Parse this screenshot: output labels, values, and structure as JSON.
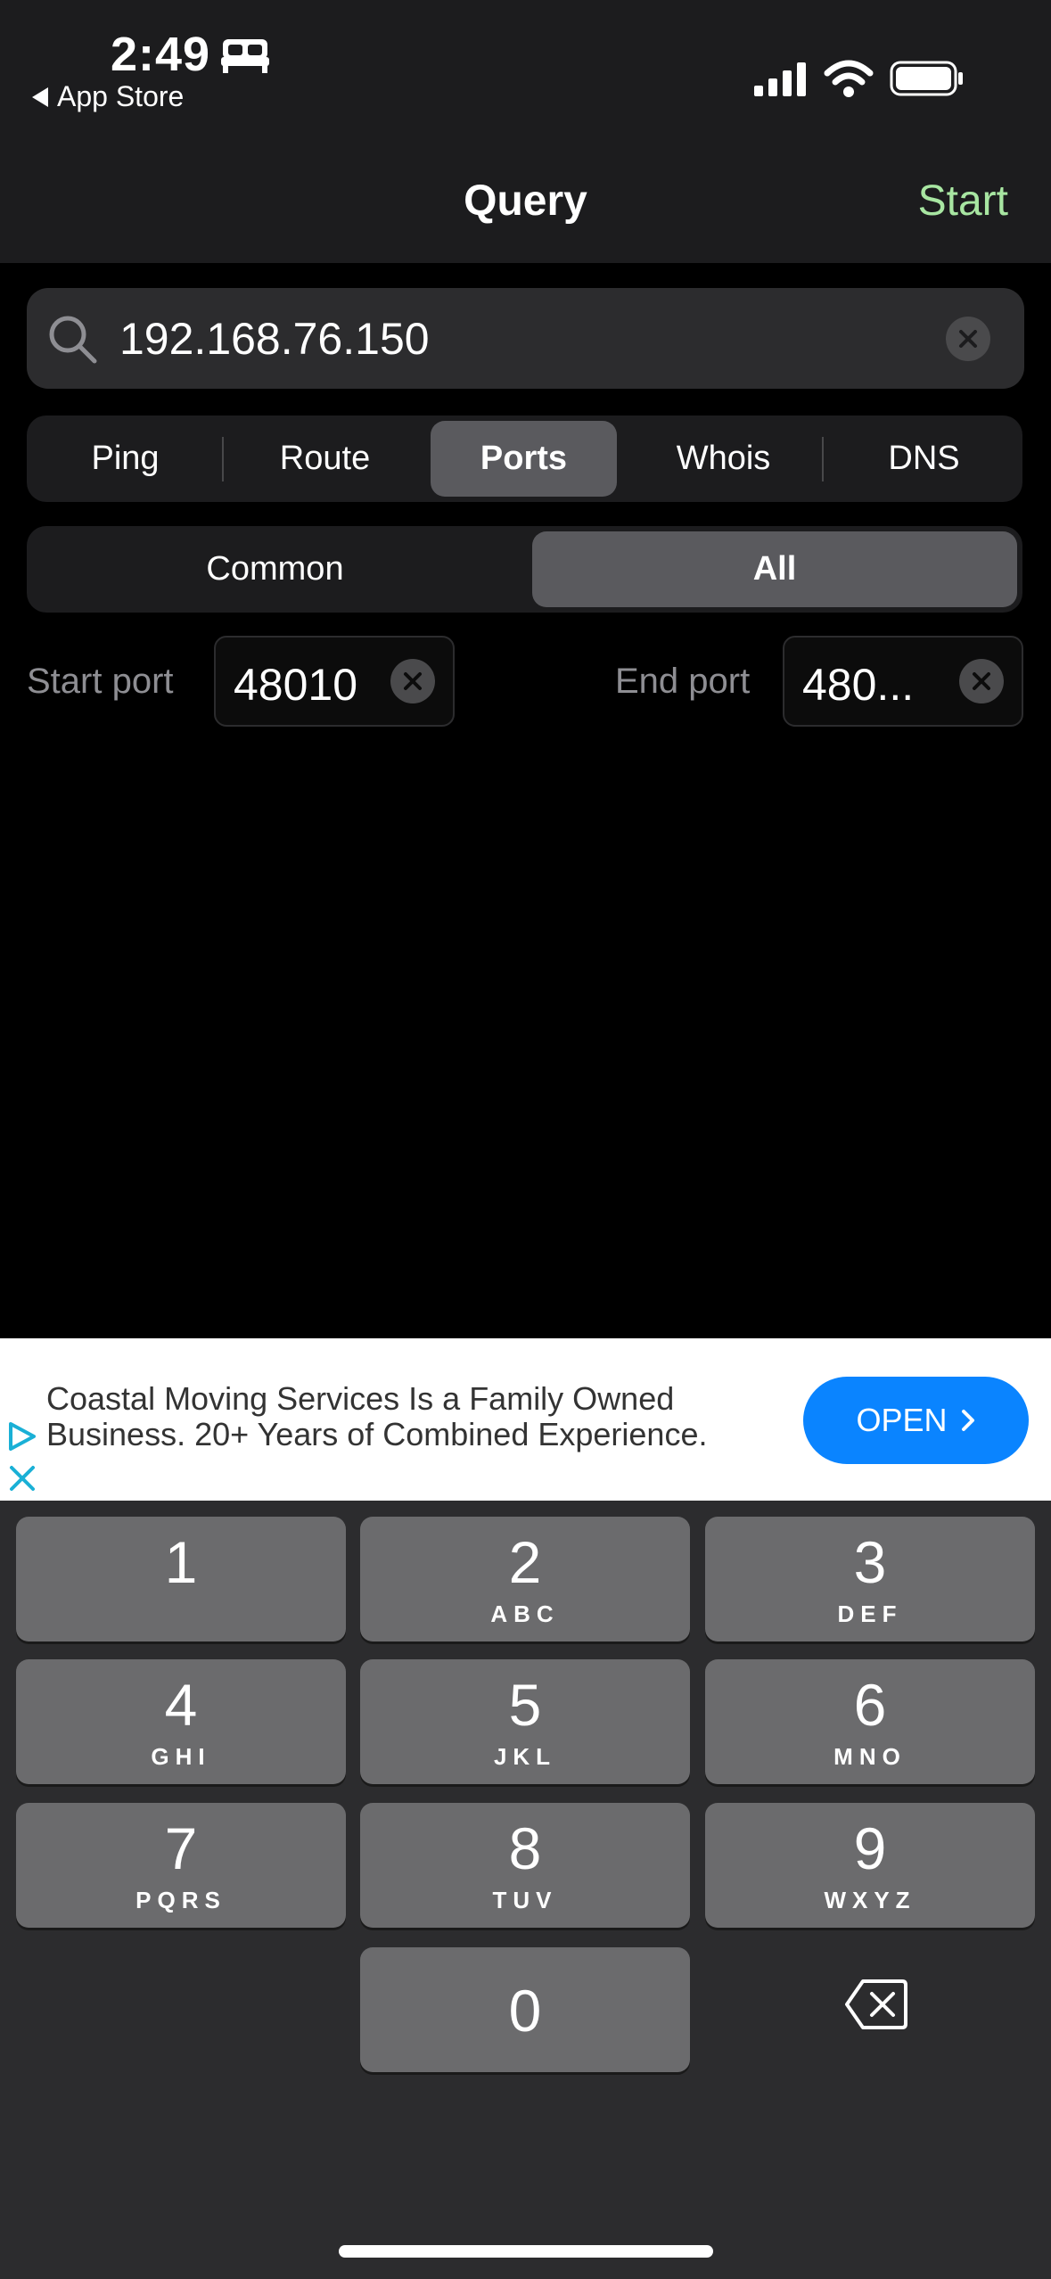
{
  "status_bar": {
    "time": "2:49",
    "back_label": "App Store",
    "icons": [
      "bed-icon",
      "signal-icon",
      "wifi-icon",
      "battery-icon"
    ]
  },
  "nav": {
    "title": "Query",
    "action_label": "Start",
    "action_color": "#a8e6a2"
  },
  "search": {
    "value": "192.168.76.150",
    "icon": "search-icon"
  },
  "tabs": [
    {
      "label": "Ping",
      "active": false
    },
    {
      "label": "Route",
      "active": false
    },
    {
      "label": "Ports",
      "active": true
    },
    {
      "label": "Whois",
      "active": false
    },
    {
      "label": "DNS",
      "active": false
    }
  ],
  "port_mode": [
    {
      "label": "Common",
      "active": false
    },
    {
      "label": "All",
      "active": true
    }
  ],
  "ports": {
    "start_label": "Start port",
    "start_value": "48010",
    "end_label": "End port",
    "end_value": "480..."
  },
  "ad": {
    "line1": "Coastal Moving Services Is a Family Owned",
    "line2": "Business. 20+ Years of Combined Experience.",
    "button_label": "OPEN",
    "button_color": "#0a84ff"
  },
  "keypad": {
    "keys": [
      {
        "num": "1",
        "letters": ""
      },
      {
        "num": "2",
        "letters": "ABC"
      },
      {
        "num": "3",
        "letters": "DEF"
      },
      {
        "num": "4",
        "letters": "GHI"
      },
      {
        "num": "5",
        "letters": "JKL"
      },
      {
        "num": "6",
        "letters": "MNO"
      },
      {
        "num": "7",
        "letters": "PQRS"
      },
      {
        "num": "8",
        "letters": "TUV"
      },
      {
        "num": "9",
        "letters": "WXYZ"
      },
      {
        "num": "0",
        "letters": ""
      }
    ]
  }
}
